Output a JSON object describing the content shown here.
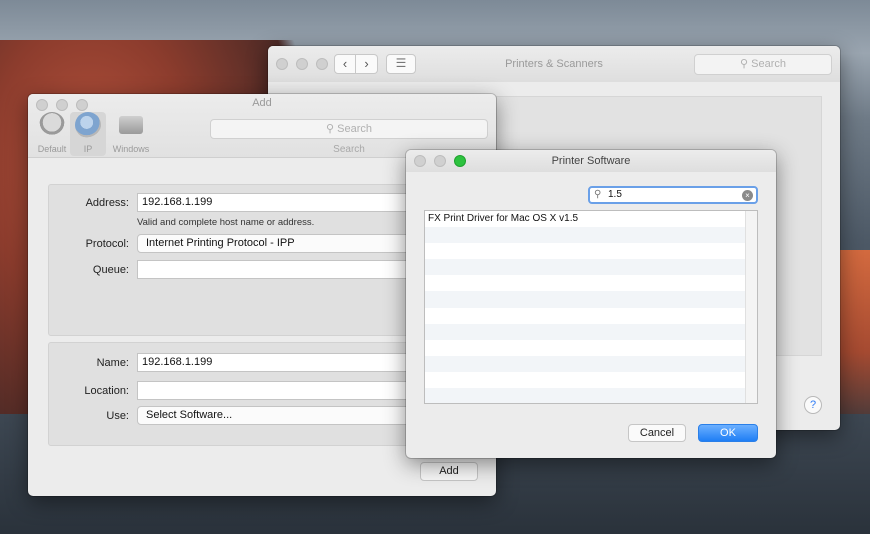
{
  "printers_window": {
    "title": "Printers & Scanners",
    "search_placeholder": "Search",
    "back_label": "‹",
    "forward_label": "›",
    "grid_label": "☰",
    "help_label": "?"
  },
  "add_window": {
    "title": "Add",
    "toolbar": [
      {
        "label": "Default",
        "icon": "printer-icon"
      },
      {
        "label": "IP",
        "icon": "globe-icon"
      },
      {
        "label": "Windows",
        "icon": "windows-printer-icon"
      }
    ],
    "search_placeholder": "Search",
    "search_label": "Search",
    "address_label": "Address:",
    "address_value": "192.168.1.199",
    "address_hint": "Valid and complete host name or address.",
    "protocol_label": "Protocol:",
    "protocol_value": "Internet Printing Protocol - IPP",
    "queue_label": "Queue:",
    "queue_value": "",
    "name_label": "Name:",
    "name_value": "192.168.1.199",
    "location_label": "Location:",
    "location_value": "",
    "use_label": "Use:",
    "use_value": "Select Software...",
    "add_button": "Add"
  },
  "software_sheet": {
    "title": "Printer Software",
    "search_value": "1.5",
    "items": [
      "FX Print Driver for Mac OS X v1.5"
    ],
    "cancel_button": "Cancel",
    "ok_button": "OK"
  }
}
